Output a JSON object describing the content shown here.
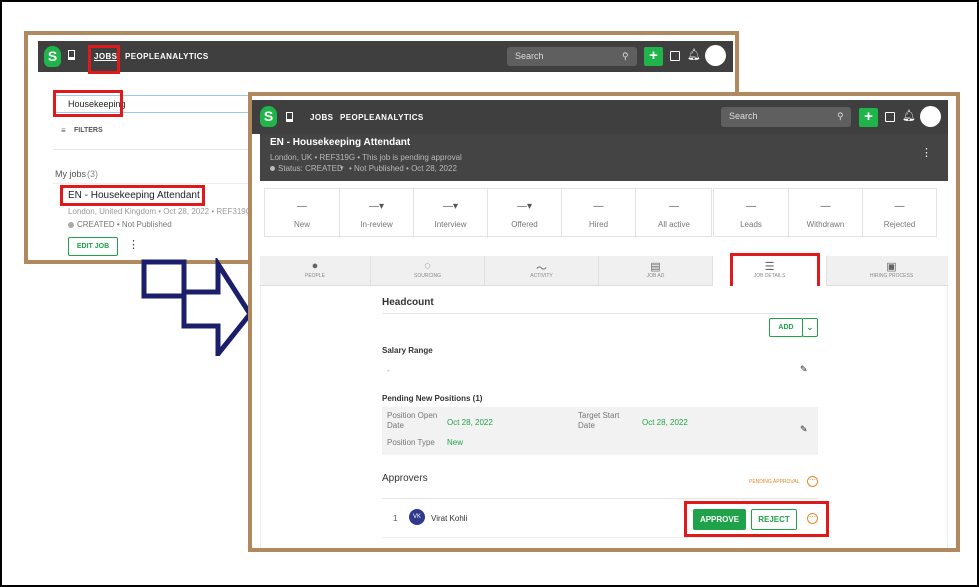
{
  "back_window": {
    "nav": {
      "jobs": "JOBS",
      "people": "PEOPLE",
      "analytics": "ANALYTICS",
      "search_placeholder": "Search",
      "logo": "S"
    },
    "search_value": "Housekeeping",
    "filters": "FILTERS",
    "my_jobs": "My jobs",
    "my_jobs_count": "(3)",
    "job_title": "EN - Housekeeping Attendant",
    "job_meta": "London, United Kingdom  •  Oct 28, 2022  •  REF319G",
    "job_status": "CREATED  •  Not Published",
    "edit_job": "EDIT JOB"
  },
  "front_window": {
    "nav": {
      "jobs": "JOBS",
      "people": "PEOPLE",
      "analytics": "ANALYTICS",
      "search_placeholder": "Search",
      "logo": "S"
    },
    "header": {
      "title": "EN - Housekeeping Attendant",
      "meta": "London, UK  •  REF319G  •  This job is pending approval",
      "status": "Status: CREATED",
      "publish": "•  Not Published  •  Oct 28, 2022"
    },
    "stats": [
      {
        "value": "—",
        "label": "New"
      },
      {
        "value": "—▾",
        "label": "In-review"
      },
      {
        "value": "—▾",
        "label": "Interview"
      },
      {
        "value": "—▾",
        "label": "Offered"
      },
      {
        "value": "—",
        "label": "Hired"
      },
      {
        "value": "—",
        "label": "All active"
      },
      {
        "value": "—",
        "label": "Leads"
      },
      {
        "value": "—",
        "label": "Withdrawn"
      },
      {
        "value": "—",
        "label": "Rejected"
      }
    ],
    "tabs": [
      {
        "label": "PEOPLE",
        "icon": "person-icon"
      },
      {
        "label": "SOURCING",
        "icon": "sourcing-icon"
      },
      {
        "label": "ACTIVITY",
        "icon": "activity-icon"
      },
      {
        "label": "JOB AD",
        "icon": "document-icon"
      },
      {
        "label": "JOB DETAILS",
        "icon": "sliders-icon"
      },
      {
        "label": "HIRING PROCESS",
        "icon": "id-card-icon"
      }
    ],
    "headcount": "Headcount",
    "add": "ADD",
    "salary_range": "Salary Range",
    "salary_value": "-",
    "pending_positions": "Pending New Positions (1)",
    "position_open_date_label": "Position Open Date",
    "position_open_date": "Oct 28, 2022",
    "target_start_date_label": "Target Start Date",
    "target_start_date": "Oct 28, 2022",
    "position_type_label": "Position Type",
    "position_type": "New",
    "approvers": "Approvers",
    "pending_approval": "PENDING APPROVAL",
    "approver_index": "1",
    "approver_initials": "VK",
    "approver_name": "Virat Kohli",
    "approve": "APPROVE",
    "reject": "REJECT"
  },
  "colors": {
    "frame": "#b08a5e",
    "highlight": "#e0191b",
    "accent": "#20b54a",
    "nav": "#3f3f3f",
    "arrow": "#1b1f6b"
  }
}
